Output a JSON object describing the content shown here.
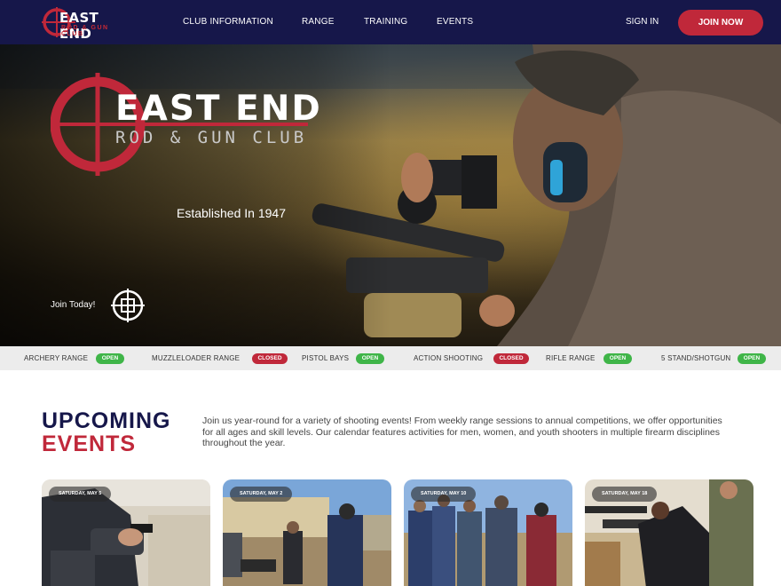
{
  "nav": {
    "logo_title": "EAST END",
    "logo_sub": "ROD & GUN CLUB",
    "links": [
      "CLUB INFORMATION",
      "RANGE",
      "TRAINING",
      "EVENTS"
    ],
    "sign_in": "SIGN IN",
    "join_now": "JOIN NOW"
  },
  "hero": {
    "title": "EAST END",
    "subtitle": "ROD & GUN CLUB",
    "established": "Established In 1947",
    "join_today": "Join Today!"
  },
  "status_bar": {
    "items": [
      {
        "label": "ARCHERY RANGE",
        "status": "OPEN"
      },
      {
        "label": "MUZZLELOADER RANGE",
        "status": "CLOSED"
      },
      {
        "label": "PISTOL BAYS",
        "status": "OPEN"
      },
      {
        "label": "ACTION SHOOTING",
        "status": "CLOSED"
      },
      {
        "label": "RIFLE RANGE",
        "status": "OPEN"
      },
      {
        "label": "5 STAND/SHOTGUN",
        "status": "OPEN"
      }
    ]
  },
  "events": {
    "heading_1": "UPCOMING",
    "heading_2": "EVENTS",
    "description": "Join us year-round for a variety of shooting events! From weekly range sessions to annual competitions, we offer opportunities for all ages and skill levels. Our calendar features activities for men, women, and youth shooters in multiple firearm disciplines throughout the year.",
    "cards": [
      {
        "date": "SATURDAY, MAY 5"
      },
      {
        "date": "SATURDAY, MAY 2"
      },
      {
        "date": "SATURDAY, MAY 10"
      },
      {
        "date": "SATURDAY, MAY 18"
      }
    ]
  },
  "colors": {
    "nav_bg": "#16174a",
    "accent_red": "#c0283a",
    "open_green": "#3fb548",
    "status_bar_bg": "#ececec"
  }
}
